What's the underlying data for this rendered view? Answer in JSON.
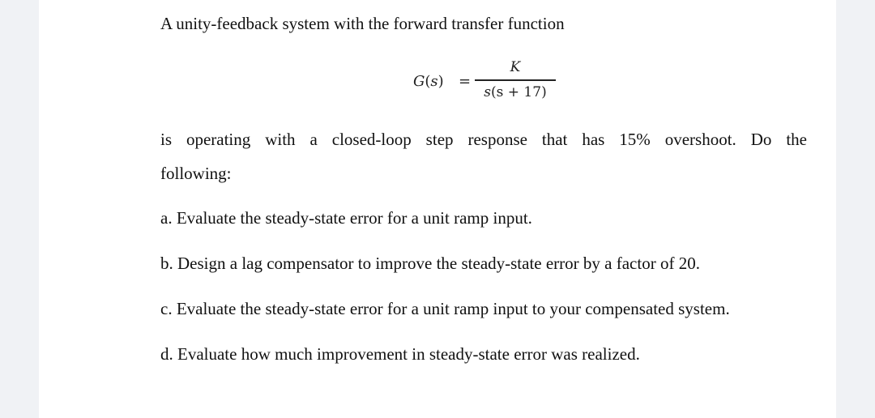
{
  "problem": {
    "intro": "A unity-feedback system with the forward transfer function",
    "equation": {
      "lhs_func": "G",
      "lhs_var": "s",
      "equals": "=",
      "numerator": "K",
      "denominator_var": "s",
      "denominator_inner": "s + 17",
      "latex": "G(s) = \\frac{K}{s(s+17)}"
    },
    "description_line1": "is operating with a closed-loop step response that has 15% overshoot. Do the",
    "description_line2": "following:",
    "items": [
      {
        "label": "a.",
        "text": "Evaluate the steady-state error for a unit ramp input."
      },
      {
        "label": "b.",
        "text": "Design a lag compensator to improve the steady-state error by a factor of 20."
      },
      {
        "label": "c.",
        "text": "Evaluate the steady-state error for a unit ramp input to your compensated system."
      },
      {
        "label": "d.",
        "text": "Evaluate how much improvement in steady-state error was realized."
      }
    ]
  },
  "colors": {
    "background": "#f0f2f5",
    "page": "#ffffff",
    "text": "#111111"
  }
}
